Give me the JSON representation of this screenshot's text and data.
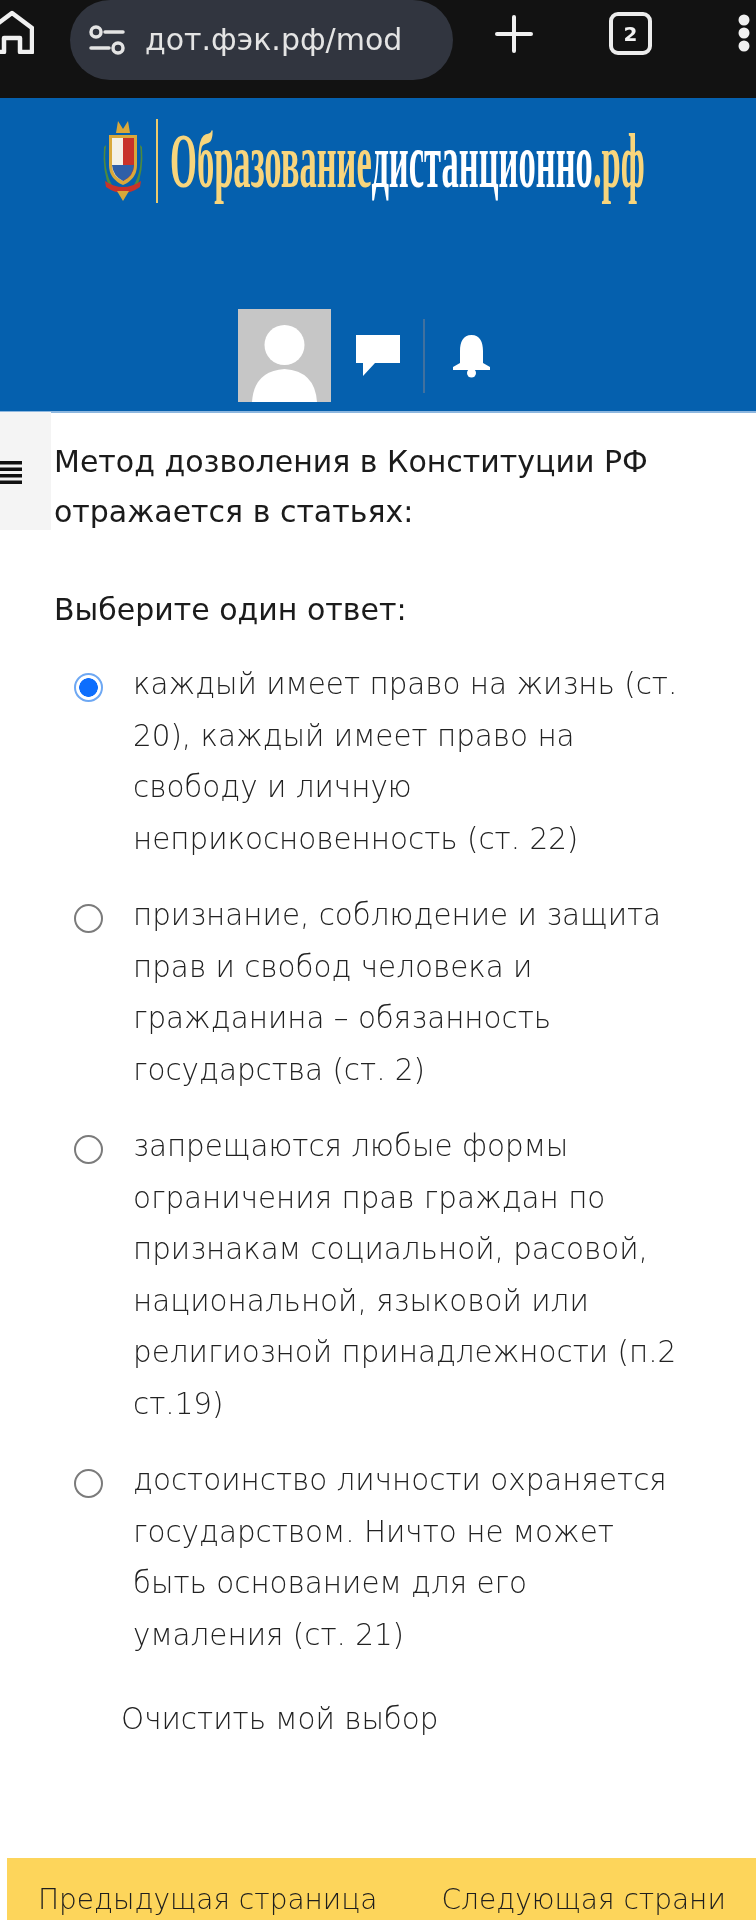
{
  "browser": {
    "url": "дот.фэк.рф/mod",
    "tab_count": "2"
  },
  "header": {
    "logo": [
      {
        "text": "Образование",
        "kind": "accent"
      },
      {
        "text": "дистанционно",
        "kind": "plain"
      },
      {
        "text": ".рф",
        "kind": "accent"
      }
    ]
  },
  "question": {
    "text": "Метод дозволения в Конституции РФ отражается в статьях:",
    "prompt": "Выберите один ответ:"
  },
  "answers": [
    {
      "text": "каждый имеет право на жизнь (ст. 20), каждый имеет право на свободу и личную неприкосновенность (ст. 22)",
      "selected": true
    },
    {
      "text": "признание, соблюдение и защита прав и свобод человека и гражданина – обязанность государства (ст. 2)",
      "selected": false
    },
    {
      "text": "запрещаются любые формы ограничения прав граждан по признакам социальной, расовой, национальной, языковой или религиозной принадлежности (п.2 ст.19)",
      "selected": false
    },
    {
      "text": "достоинство личности охраняется государством. Ничто не может быть основанием для его умаления (ст. 21)",
      "selected": false
    }
  ],
  "clear_choice": "Очистить мой выбор",
  "navigation": {
    "previous": "Предыдущая страница",
    "next": "Следующая страни"
  }
}
